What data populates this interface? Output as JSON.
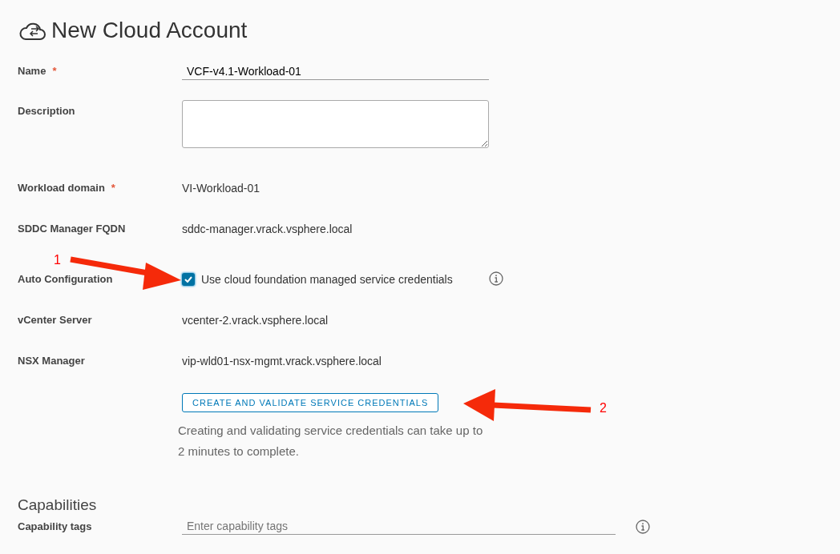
{
  "title": "New Cloud Account",
  "fields": [
    {
      "kind": "text-input",
      "label": "Name",
      "required_mark": "*",
      "value": "VCF-v4.1-Workload-01"
    },
    {
      "kind": "textarea",
      "label": "Description"
    },
    {
      "kind": "static",
      "label": "Workload domain",
      "required_mark": "*",
      "value": "VI-Workload-01"
    },
    {
      "kind": "static",
      "label": "SDDC Manager FQDN",
      "value": "sddc-manager.vrack.vsphere.local"
    },
    {
      "kind": "checkbox",
      "label": "Auto Configuration",
      "checked": true,
      "text": "Use cloud foundation managed service credentials",
      "info": true
    },
    {
      "kind": "static",
      "label": "vCenter Server",
      "value": "vcenter-2.vrack.vsphere.local"
    },
    {
      "kind": "static",
      "label": "NSX Manager",
      "value": "vip-wld01-nsx-mgmt.vrack.vsphere.local"
    }
  ],
  "action_button": "CREATE AND VALIDATE SERVICE CREDENTIALS",
  "help_text": "Creating and validating service credentials can take up to 2 minutes to complete.",
  "capabilities": {
    "heading": "Capabilities",
    "label": "Capability tags",
    "placeholder": "Enter capability tags",
    "info": true
  },
  "annotations": [
    {
      "label": "1"
    },
    {
      "label": "2"
    }
  ]
}
